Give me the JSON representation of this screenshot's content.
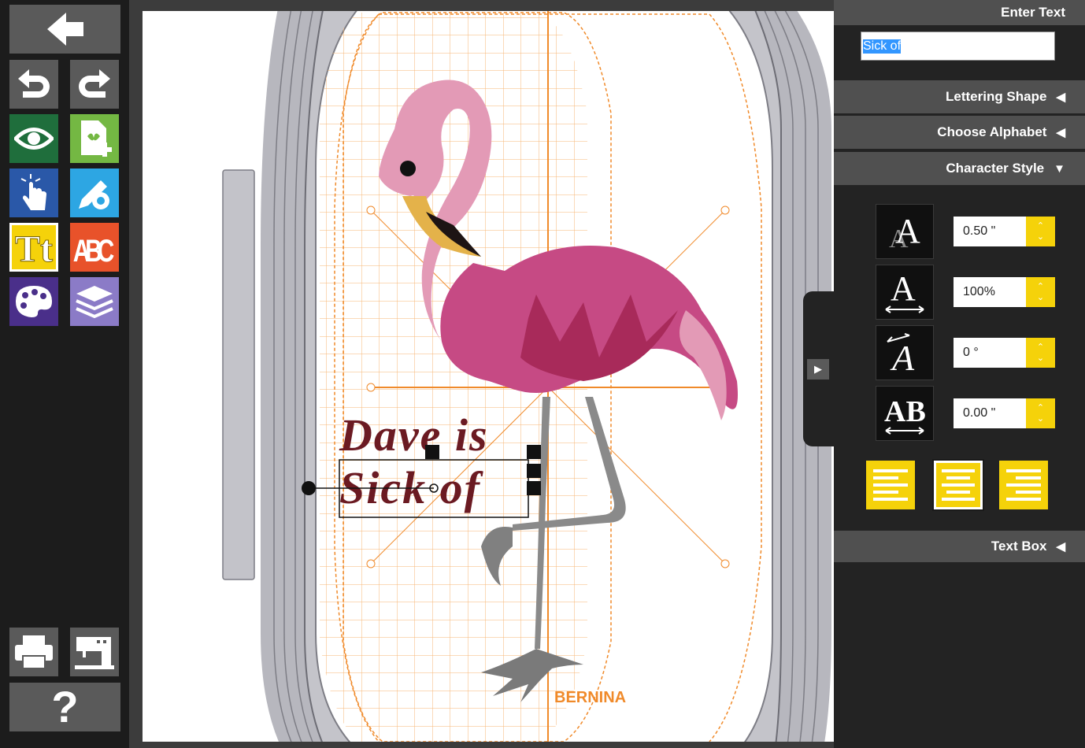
{
  "right_panel": {
    "enter_text_header": "Enter Text",
    "text_value": "Sick of",
    "lettering_shape": "Lettering Shape",
    "choose_alphabet": "Choose Alphabet",
    "character_style": "Character Style",
    "text_box": "Text Box",
    "collapsed_arrow": "◀",
    "expanded_arrow": "▼",
    "size_value": "0.50 \"",
    "width_value": "100%",
    "slant_value": "0 °",
    "spacing_value": "0.00 \""
  },
  "canvas": {
    "text_line_1": "Dave is",
    "text_line_2": "Sick of",
    "brand": "BERNINA"
  },
  "left_toolbar": {
    "help_label": "?"
  },
  "icons": {
    "back": "back-arrow-icon",
    "undo": "undo-icon",
    "redo": "redo-icon",
    "view": "eye-icon",
    "add_design": "add-design-icon",
    "select": "touch-select-icon",
    "edit_settings": "edit-gear-icon",
    "text": "text-tool-icon",
    "monogram": "monogram-icon",
    "colors": "palette-icon",
    "layers": "layers-icon",
    "print": "printer-icon",
    "send_machine": "sewing-machine-icon"
  },
  "colors": {
    "accent_yellow": "#f5d20a",
    "grid_orange": "#f39a3a",
    "text_maroon": "#6b1a22",
    "flamingo_pink": "#e08aa6"
  }
}
